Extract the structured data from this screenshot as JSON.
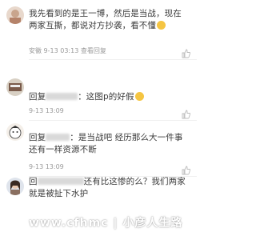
{
  "comments": [
    {
      "text": "我先看到的是王一博，然后是当战，现在两家互撕，都说对方抄袭，看不懂",
      "meta": "安徽 9-13 03:13 查看回复"
    },
    {
      "text": "回复",
      "text_tail": "：这图p的好假",
      "meta": "9-13 13:09"
    },
    {
      "text": "回复",
      "text_mid": "：是当战吧 经历那么大一件事 还有一样资源不断",
      "meta": "9-13 13:09"
    },
    {
      "text": "回",
      "text_mid": "还有比这惨的么？我们两家就是被扯下水护",
      "meta": ""
    }
  ],
  "watermark": "www.cfhmc | 小彦人生路",
  "colors": {
    "meta": "#9a9a9a",
    "text": "#3a3a3a",
    "emoji": "#f5c542"
  },
  "icons": [
    "avatar",
    "like-icon",
    "emoji-icon"
  ]
}
